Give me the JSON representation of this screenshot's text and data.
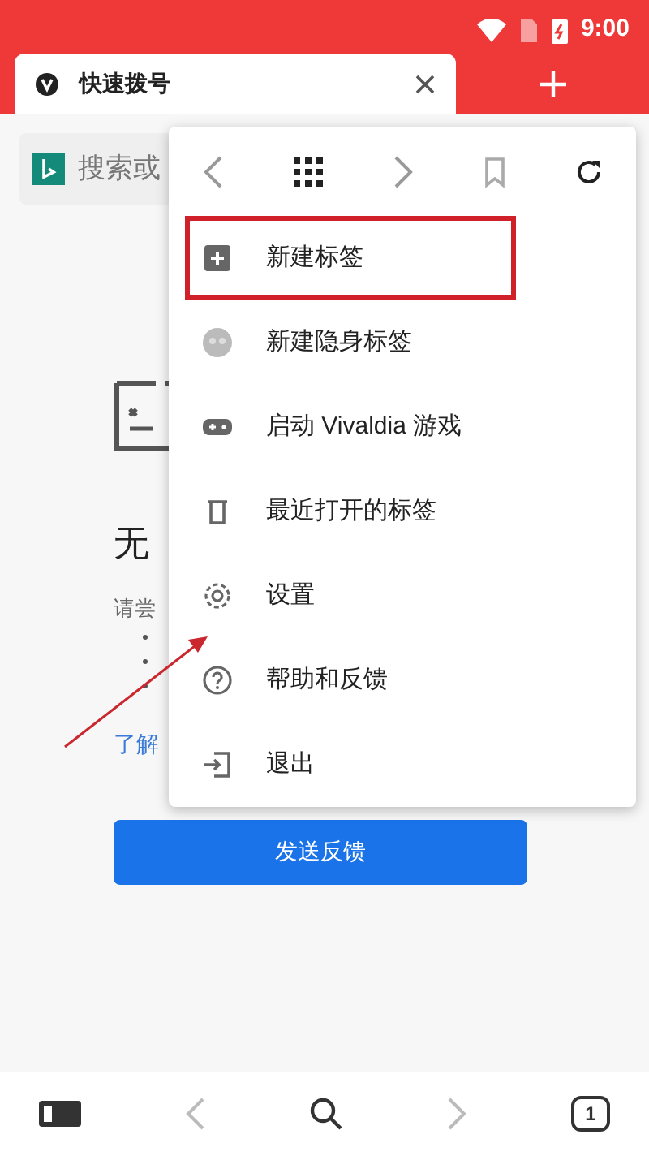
{
  "status_bar": {
    "time": "9:00"
  },
  "tab": {
    "title": "快速拨号",
    "selected": true
  },
  "address_bar": {
    "placeholder": "搜索或"
  },
  "error_page": {
    "title": "无",
    "hint": "请尝",
    "link": "了解",
    "button": "发送反馈"
  },
  "menu": {
    "items": [
      {
        "label": "新建标签",
        "highlighted": true
      },
      {
        "label": "新建隐身标签",
        "highlighted": false
      },
      {
        "label": "启动 Vivaldia 游戏",
        "highlighted": false
      },
      {
        "label": "最近打开的标签",
        "highlighted": false
      },
      {
        "label": "设置",
        "highlighted": false
      },
      {
        "label": "帮助和反馈",
        "highlighted": false
      },
      {
        "label": "退出",
        "highlighted": false
      }
    ]
  },
  "bottom_bar": {
    "tab_count": "1"
  }
}
